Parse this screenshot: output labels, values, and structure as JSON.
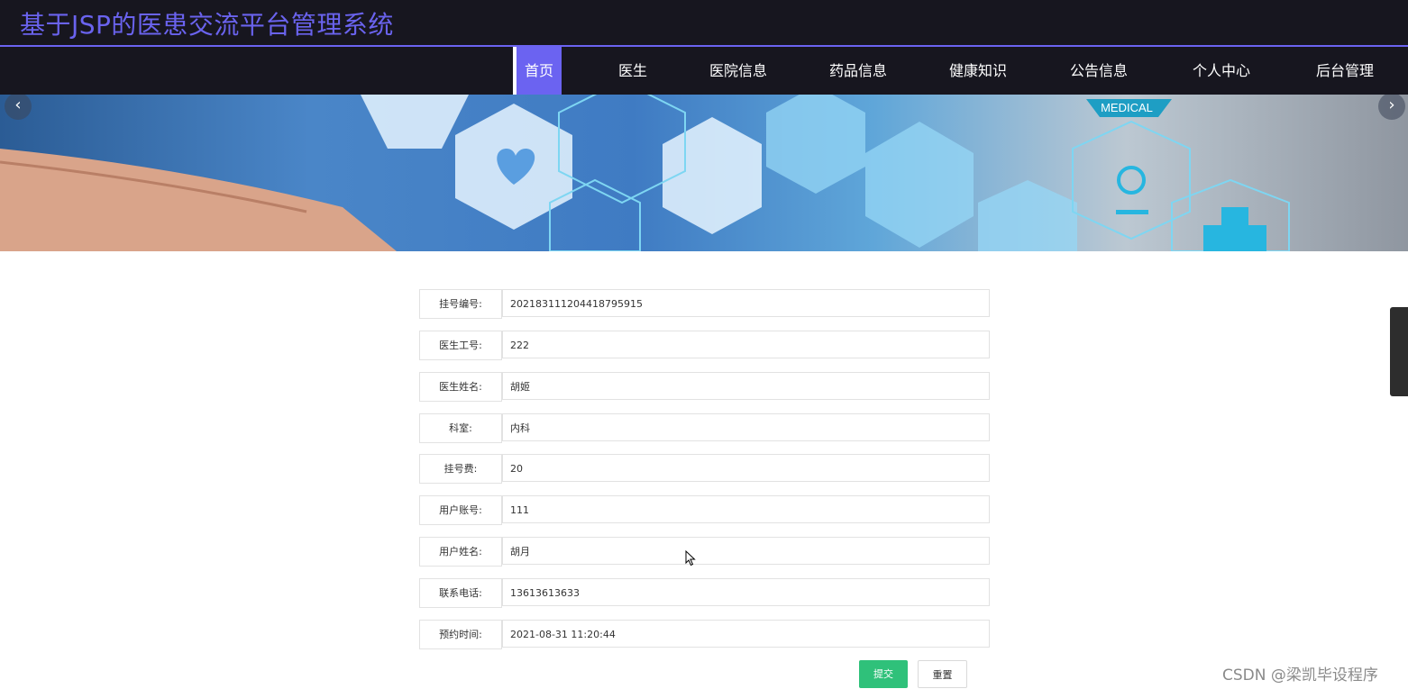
{
  "header": {
    "title": "基于JSP的医患交流平台管理系统"
  },
  "nav": {
    "items": [
      {
        "label": "首页",
        "active": true
      },
      {
        "label": "医生"
      },
      {
        "label": "医院信息"
      },
      {
        "label": "药品信息"
      },
      {
        "label": "健康知识"
      },
      {
        "label": "公告信息"
      },
      {
        "label": "个人中心"
      },
      {
        "label": "后台管理"
      }
    ]
  },
  "banner": {
    "text": "MEDICAL",
    "prev_icon": "chevron-left-icon",
    "next_icon": "chevron-right-icon"
  },
  "form": {
    "fields": [
      {
        "label": "挂号编号:",
        "value": "20218311120441879591​5"
      },
      {
        "label": "医生工号:",
        "value": "222"
      },
      {
        "label": "医生姓名:",
        "value": "胡姬"
      },
      {
        "label": "科室:",
        "value": "内科"
      },
      {
        "label": "挂号费:",
        "value": "20"
      },
      {
        "label": "用户账号:",
        "value": "111"
      },
      {
        "label": "用户姓名:",
        "value": "胡月"
      },
      {
        "label": "联系电话:",
        "value": "13613613633"
      },
      {
        "label": "预约时间:",
        "value": "2021-08-31 11:20:44"
      }
    ],
    "submit_label": "提交",
    "reset_label": "重置"
  },
  "watermark": "CSDN @梁凯毕设程序",
  "colors": {
    "accent": "#6b63f1",
    "header_bg": "#17161f",
    "submit": "#2fc17a"
  }
}
